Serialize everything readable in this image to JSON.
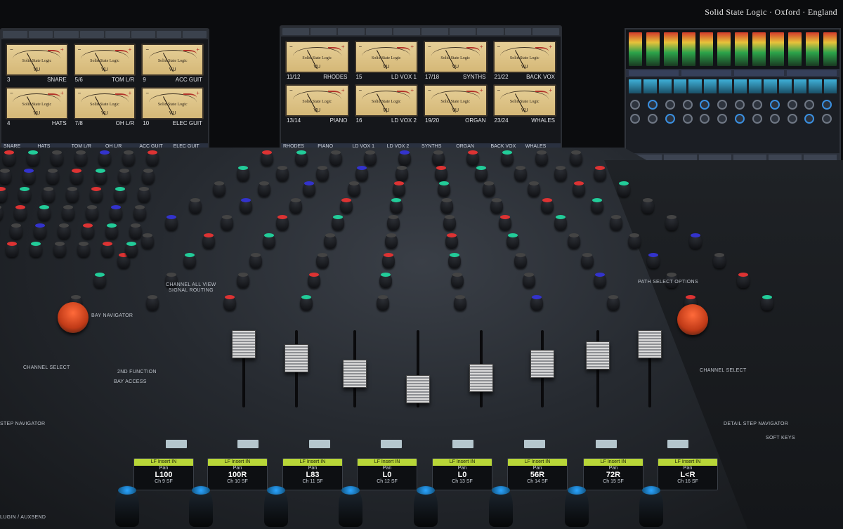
{
  "brand": "Solid State Logic · Oxford · England",
  "left_screen": {
    "meters": [
      {
        "num": "3",
        "name": "SNARE"
      },
      {
        "num": "5/6",
        "name": "TOM L/R"
      },
      {
        "num": "9",
        "name": "ACC GUIT"
      },
      {
        "num": "4",
        "name": "HATS"
      },
      {
        "num": "7/8",
        "name": "OH L/R"
      },
      {
        "num": "10",
        "name": "ELEC GUIT"
      }
    ],
    "bottom": [
      "SNARE",
      "HATS",
      "TOM L/R",
      "OH L/R",
      "ACC GUIT",
      "ELEC GUIT"
    ]
  },
  "center_screen": {
    "meters": [
      {
        "num": "11/12",
        "name": "RHODES"
      },
      {
        "num": "15",
        "name": "LD VOX 1"
      },
      {
        "num": "17/18",
        "name": "SYNTHS"
      },
      {
        "num": "21/22",
        "name": "BACK VOX"
      },
      {
        "num": "13/14",
        "name": "PIANO"
      },
      {
        "num": "16",
        "name": "LD VOX 2"
      },
      {
        "num": "19/20",
        "name": "ORGAN"
      },
      {
        "num": "23/24",
        "name": "WHALES"
      }
    ],
    "bottom": [
      "RHODES",
      "PIANO",
      "LD VOX 1",
      "LD VOX 2",
      "SYNTHS",
      "ORGAN",
      "BACK VOX",
      "WHALES"
    ]
  },
  "vu": {
    "logo": "Solid State Logic",
    "label": "VU",
    "plus": "+",
    "minus": "−"
  },
  "console": {
    "labels": {
      "channel_select_left": "CHANNEL SELECT",
      "function": "2nd FUNCTION",
      "bay_access": "BAY ACCESS",
      "step_navigator": "STEP NAVIGATOR",
      "plugin_auxsend": "LUGIN / AUXSEND",
      "channel_select_right": "CHANNEL SELECT",
      "detail_step_navigator": "DETAIL STEP NAVIGATOR",
      "soft_keys": "SOFT KEYS",
      "path_select_options": "PATH SELECT OPTIONS",
      "channel_all_view": "CHANNEL ALL VIEW",
      "signal_routing": "SIGNAL ROUTING",
      "bay_navigator": "BAY NAVIGATOR"
    },
    "lcds": [
      {
        "title": "LF Insert IN",
        "sub": "Pan",
        "value": "L100",
        "ch": "Ch 9 SF"
      },
      {
        "title": "LF Insert IN",
        "sub": "Pan",
        "value": "100R",
        "ch": "Ch 10 SF"
      },
      {
        "title": "LF Insert IN",
        "sub": "Pan",
        "value": "L83",
        "ch": "Ch 11 SF"
      },
      {
        "title": "LF Insert IN",
        "sub": "Pan",
        "value": "L0",
        "ch": "Ch 12 SF"
      },
      {
        "title": "LF Insert IN",
        "sub": "Pan",
        "value": "L0",
        "ch": "Ch 13 SF"
      },
      {
        "title": "LF Insert IN",
        "sub": "Pan",
        "value": "56R",
        "ch": "Ch 14 SF"
      },
      {
        "title": "LF Insert IN",
        "sub": "Pan",
        "value": "72R",
        "ch": "Ch 15 SF"
      },
      {
        "title": "LF Insert IN",
        "sub": "Pan",
        "value": "L<R",
        "ch": "Ch 16 SF"
      }
    ]
  },
  "colors": {
    "vu_face": "#d9bf80",
    "orange_knob": "#e8552a",
    "blue_cap": "#2aa4ff",
    "lcd_title": "#b8d638"
  }
}
